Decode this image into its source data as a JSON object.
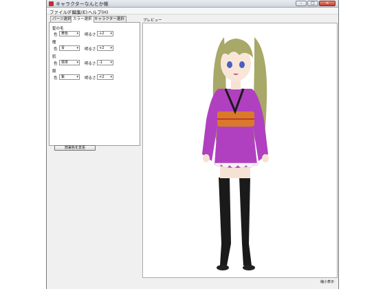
{
  "window": {
    "title": "キャラクターなんとか帳",
    "controls": {
      "minimize": "–",
      "maximize": "□",
      "close": "×"
    }
  },
  "menu": {
    "items": [
      "ファイル(F)",
      "編集(E)",
      "ヘルプ(H)"
    ]
  },
  "tabs": [
    "パーツ選択",
    "カラー選択",
    "キャラクター選択"
  ],
  "active_tab": "カラー選択",
  "color_panel": {
    "sections": [
      {
        "label": "髪の毛",
        "color_label": "色",
        "color_value": "黄色",
        "brightness_label": "明るさ",
        "brightness_value": "+2"
      },
      {
        "label": "瞳",
        "color_label": "色",
        "color_value": "青",
        "brightness_label": "明るさ",
        "brightness_value": "+2"
      },
      {
        "label": "肌",
        "color_label": "色",
        "color_value": "標準",
        "brightness_label": "明るさ",
        "brightness_value": "-1"
      },
      {
        "label": "服",
        "color_label": "色",
        "color_value": "紫",
        "brightness_label": "明るさ",
        "brightness_value": "+2"
      }
    ],
    "apply_button": "部署色を変更"
  },
  "preview": {
    "label": "プレビュー",
    "status": "縮小表示"
  },
  "colors": {
    "hair": "#a8a868",
    "kimono": "#b040c0",
    "obi": "#d87a2a",
    "stockings": "#1a1a1a",
    "titlebar": "#d9dfe6"
  }
}
